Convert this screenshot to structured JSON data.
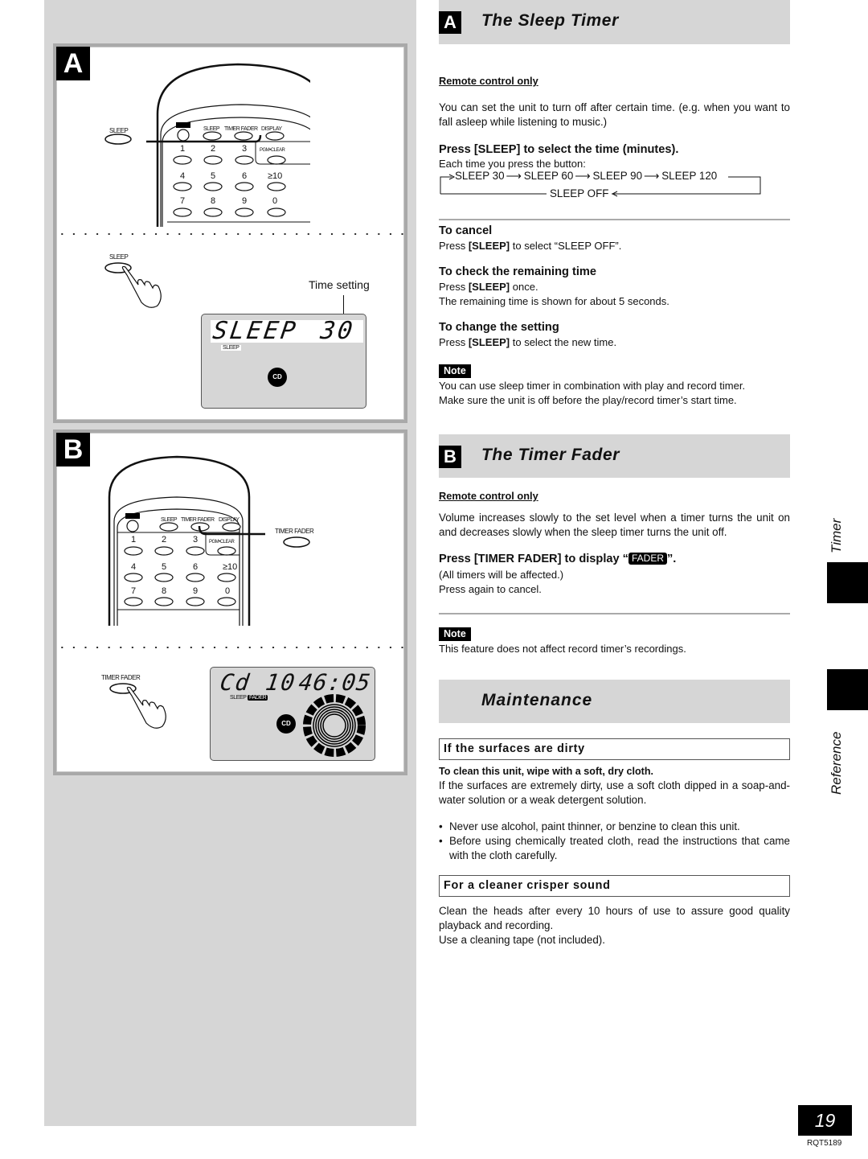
{
  "figures": {
    "a": {
      "letter": "A",
      "remote_side_label": "SLEEP",
      "remote_top_buttons": [
        "SLEEP",
        "TIMER FADER",
        "DISPLAY"
      ],
      "remote_keys": [
        "1",
        "2",
        "3",
        "PGM•CLEAR",
        "4",
        "5",
        "6",
        "≥10",
        "7",
        "8",
        "9",
        "0"
      ],
      "press_label": "SLEEP",
      "callout": "Time setting",
      "lcd_main_left": "SLEEP",
      "lcd_main_right": "30",
      "lcd_indicator": "SLEEP",
      "lcd_badge": "CD"
    },
    "b": {
      "letter": "B",
      "remote_side_label": "TIMER FADER",
      "remote_top_buttons": [
        "SLEEP",
        "TIMER FADER",
        "DISPLAY"
      ],
      "remote_keys": [
        "1",
        "2",
        "3",
        "PGM•CLEAR",
        "4",
        "5",
        "6",
        "≥10",
        "7",
        "8",
        "9",
        "0"
      ],
      "press_label": "TIMER FADER",
      "lcd_main_left": "Cd 10",
      "lcd_main_right": "46:05",
      "lcd_indicator_sleep": "SLEEP",
      "lcd_indicator_fader": "FADER",
      "lcd_badge": "CD"
    }
  },
  "sleep_timer": {
    "letter": "A",
    "title": "The Sleep Timer",
    "remote_only": "Remote control only",
    "intro": "You can set the unit to turn off after certain time. (e.g. when you want to fall asleep while listening to music.)",
    "step": "Press [SLEEP] to select the time (minutes).",
    "each_time": "Each time you press the button:",
    "cycle": [
      "SLEEP 30",
      "SLEEP 60",
      "SLEEP 90",
      "SLEEP 120"
    ],
    "cycle_end": "SLEEP OFF",
    "cancel": {
      "heading": "To cancel",
      "pre": "Press ",
      "key": "[SLEEP]",
      "post": " to select “SLEEP OFF”."
    },
    "check": {
      "heading": "To check the remaining time",
      "pre": "Press ",
      "key": "[SLEEP]",
      "post": " once.",
      "line2": "The remaining time is shown for about 5 seconds."
    },
    "change": {
      "heading": "To change the setting",
      "pre": "Press ",
      "key": "[SLEEP]",
      "post": " to select the new time."
    },
    "note_label": "Note",
    "note_lines": [
      "You can use sleep timer in combination with play and record timer.",
      "Make sure the unit is off before the play/record timer’s start time."
    ]
  },
  "timer_fader": {
    "letter": "B",
    "title": "The Timer Fader",
    "remote_only": "Remote control only",
    "intro": "Volume increases slowly to the set level when a timer turns the unit on and decreases slowly when the sleep timer turns the unit off.",
    "step_pre": "Press [TIMER FADER] to display “",
    "step_badge": "FADER",
    "step_post": "”.",
    "line1": "(All timers will be affected.)",
    "line2": "Press again to cancel.",
    "note_label": "Note",
    "note": "This feature does not affect record timer’s recordings."
  },
  "maintenance": {
    "title": "Maintenance",
    "dirty": {
      "heading": "If the surfaces are dirty",
      "bold_line": "To clean this unit, wipe with a soft, dry cloth.",
      "text": "If the surfaces are extremely dirty, use a soft cloth dipped in a soap-and-water solution or a weak detergent solution.",
      "bullets": [
        "Never use alcohol, paint thinner, or benzine to clean this unit.",
        "Before using chemically treated cloth, read the instructions that came with the cloth carefully."
      ]
    },
    "sound": {
      "heading": "For a cleaner crisper sound",
      "text": "Clean the heads after every 10 hours of use to assure good quality playback and recording.",
      "text2": "Use a cleaning tape (not included)."
    }
  },
  "side_tabs": {
    "timer": "Timer",
    "reference": "Reference"
  },
  "footer": {
    "page_number": "19",
    "doc_code": "RQT5189"
  }
}
